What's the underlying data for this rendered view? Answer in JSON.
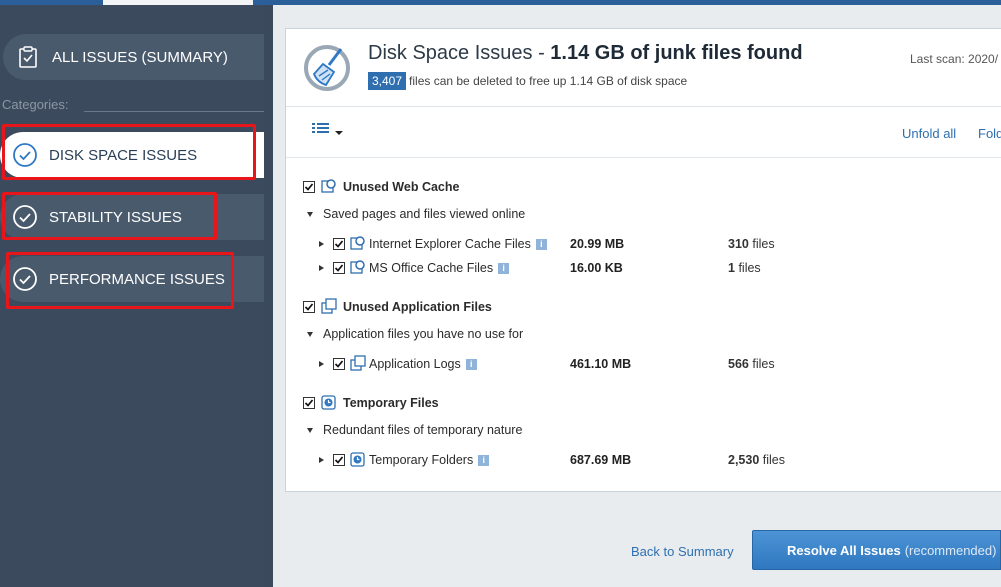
{
  "sidebar": {
    "summary_label": "ALL ISSUES (SUMMARY)",
    "categories_label": "Categories:",
    "items": [
      {
        "label": "DISK SPACE ISSUES",
        "active": true
      },
      {
        "label": "STABILITY ISSUES",
        "active": false
      },
      {
        "label": "PERFORMANCE ISSUES",
        "active": false
      }
    ]
  },
  "header": {
    "title_prefix": "Disk Space Issues - ",
    "title_bold": "1.14 GB of junk files found",
    "count_badge": "3,407",
    "subtitle": "files can be deleted to free up 1.14 GB of disk space",
    "last_scan": "Last scan: 2020/"
  },
  "toolbar": {
    "unfold_all": "Unfold all",
    "fold_all": "Fold"
  },
  "groups": [
    {
      "name": "Unused Web Cache",
      "description": "Saved pages and files viewed online",
      "items": [
        {
          "name": "Internet Explorer Cache Files",
          "size": "20.99 MB",
          "count": "310",
          "unit": "files"
        },
        {
          "name": "MS Office Cache Files",
          "size": "16.00 KB",
          "count": "1",
          "unit": "files"
        }
      ]
    },
    {
      "name": "Unused Application Files",
      "description": "Application files you have no use for",
      "items": [
        {
          "name": "Application Logs",
          "size": "461.10 MB",
          "count": "566",
          "unit": "files"
        }
      ]
    },
    {
      "name": "Temporary Files",
      "description": "Redundant files of temporary nature",
      "items": [
        {
          "name": "Temporary Folders",
          "size": "687.69 MB",
          "count": "2,530",
          "unit": "files"
        }
      ]
    }
  ],
  "footer": {
    "back_label": "Back to Summary",
    "resolve_label": "Resolve All Issues",
    "resolve_note": "(recommended)"
  },
  "colors": {
    "accent": "#2f6fb0",
    "sidebar_bg": "#3b4a5c",
    "highlight": "#e8161b"
  }
}
